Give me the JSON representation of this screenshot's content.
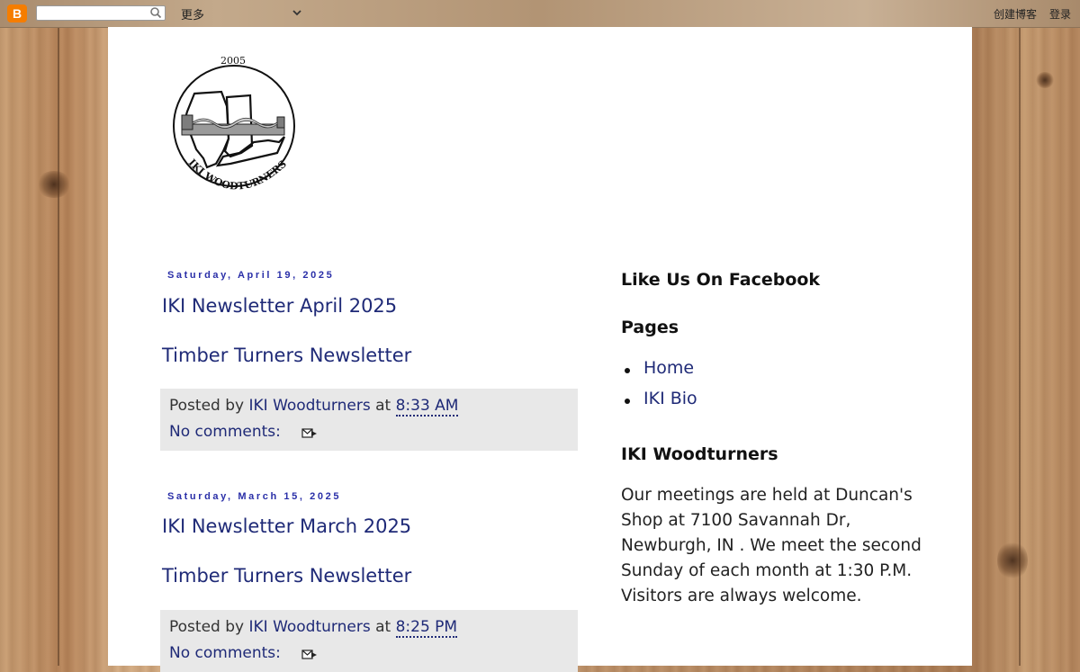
{
  "navbar": {
    "logo_letter": "B",
    "search_placeholder": "",
    "more_label": "更多",
    "create_blog_label": "创建博客",
    "login_label": "登录"
  },
  "header": {
    "logo_year": "2005",
    "logo_text": "IKI WOODTURNERS"
  },
  "posts": [
    {
      "date": "Saturday, April 19, 2025",
      "title": "IKI Newsletter April 2025",
      "body_link": "Timber Turners Newsletter",
      "posted_by_label": "Posted by",
      "author": "IKI Woodturners",
      "at_label": "at",
      "time": "8:33 AM",
      "comments": "No comments:"
    },
    {
      "date": "Saturday, March 15, 2025",
      "title": "IKI Newsletter March 2025",
      "body_link": "Timber Turners Newsletter",
      "posted_by_label": "Posted by",
      "author": "IKI Woodturners",
      "at_label": "at",
      "time": "8:25 PM",
      "comments": "No comments:"
    }
  ],
  "sidebar": {
    "facebook_title": "Like Us On Facebook",
    "pages_title": "Pages",
    "pages": [
      "Home",
      "IKI Bio"
    ],
    "about_title": "IKI Woodturners",
    "about_text": "Our meetings are held at Duncan's Shop at 7100 Savannah Dr, Newburgh, IN . We meet the second Sunday of each month at 1:30 P.M. Visitors are always welcome."
  },
  "colors": {
    "link": "#1f2a77",
    "date_header": "#2a2fa8",
    "footer_bg": "#e8e8e8",
    "blogger_orange": "#f57d00"
  }
}
